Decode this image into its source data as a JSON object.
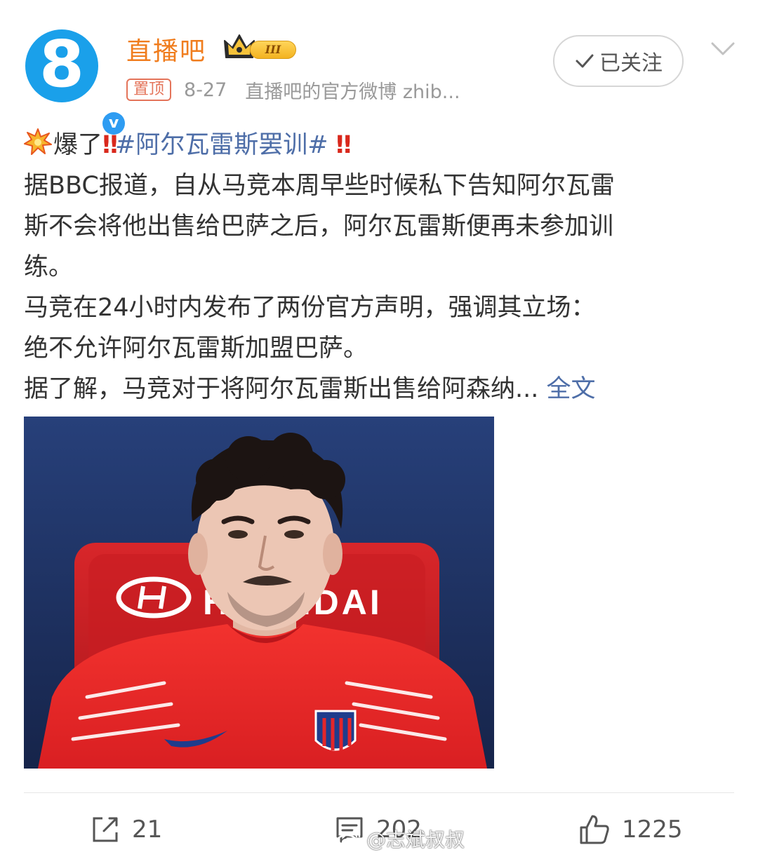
{
  "header": {
    "username": "直播吧",
    "level_badge": "III",
    "pin_label": "置顶",
    "date": "8-27",
    "source": "直播吧的官方微博 zhib...",
    "follow_label": "已关注"
  },
  "avatar": {
    "glyph": "8",
    "verified_glyph": "v"
  },
  "post": {
    "line1_prefix": "爆了",
    "line1_excl": "‼",
    "line1_hashtag": "#阿尔瓦雷斯罢训#",
    "line1_excl2": "‼",
    "line2": "据BBC报道，自从马竞本周早些时候私下告知阿尔瓦雷",
    "line3": "斯不会将他出售给巴萨之后，阿尔瓦雷斯便再未参加训",
    "line4": "练。",
    "line5": "马竞在24小时内发布了两份官方声明，强调其立场：",
    "line6": "绝不允许阿尔瓦雷斯加盟巴萨。",
    "line7": "据了解，马竞对于将阿尔瓦雷斯出售给阿森纳...",
    "fulltext_label": "全文",
    "image_text": "HYUNDAI"
  },
  "footer": {
    "repost_count": "21",
    "comment_count": "202",
    "like_count": "1225"
  },
  "watermark": {
    "text": "@志斌叔叔"
  },
  "colors": {
    "username": "#f07d1e",
    "link": "#4e6ea8",
    "pin": "#e4745a",
    "avatar_bg": "#1aa0ea"
  }
}
